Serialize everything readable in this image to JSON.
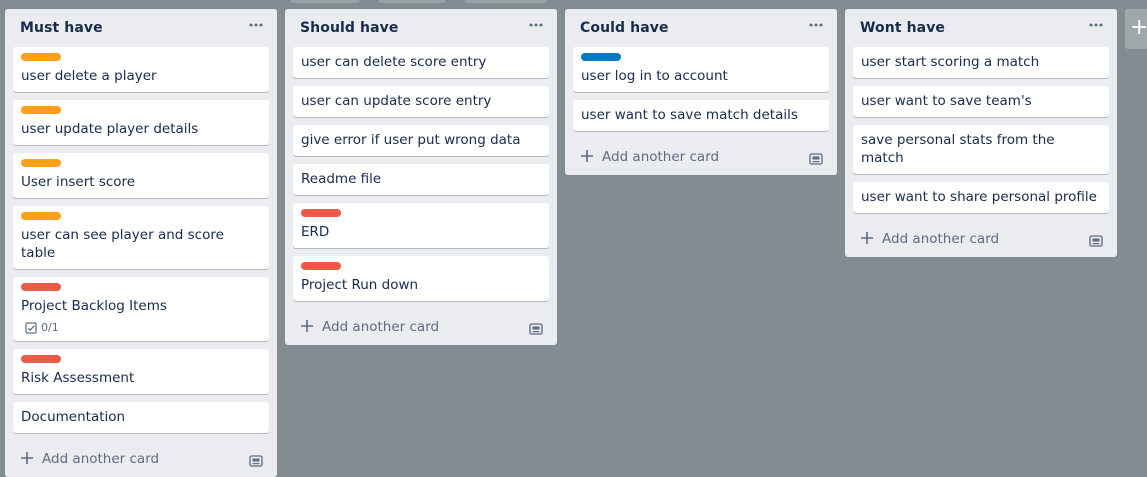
{
  "lists": [
    {
      "title": "Must have",
      "cards": [
        {
          "label": "orange",
          "text": "user delete a player"
        },
        {
          "label": "orange",
          "text": "user update player details"
        },
        {
          "label": "orange",
          "text": "User insert score"
        },
        {
          "label": "orange",
          "text": "user can see player and score table"
        },
        {
          "label": "red",
          "text": "Project Backlog Items",
          "badge": "0/1"
        },
        {
          "label": "red",
          "text": "Risk Assessment"
        },
        {
          "label": null,
          "text": "Documentation"
        }
      ],
      "add_label": "Add another card"
    },
    {
      "title": "Should have",
      "cards": [
        {
          "label": null,
          "text": "user can delete score entry"
        },
        {
          "label": null,
          "text": "user can update score entry"
        },
        {
          "label": null,
          "text": "give error if user put wrong data"
        },
        {
          "label": null,
          "text": "Readme file"
        },
        {
          "label": "red",
          "text": "ERD"
        },
        {
          "label": "red",
          "text": "Project Run down"
        }
      ],
      "add_label": "Add another card"
    },
    {
      "title": "Could have",
      "cards": [
        {
          "label": "blue",
          "text": "user log in to account"
        },
        {
          "label": null,
          "text": "user want to save match details"
        }
      ],
      "add_label": "Add another card"
    },
    {
      "title": "Wont have",
      "cards": [
        {
          "label": null,
          "text": "user start scoring a match"
        },
        {
          "label": null,
          "text": "user want to save team's"
        },
        {
          "label": null,
          "text": "save personal stats from the match"
        },
        {
          "label": null,
          "text": "user want to share personal profile"
        }
      ],
      "add_label": "Add another card"
    }
  ],
  "label_colors": {
    "orange": "#ff9f1a",
    "red": "#eb5a46",
    "blue": "#0079bf"
  },
  "icons": {
    "list_menu": "ellipsis-icon",
    "add": "plus-icon",
    "template": "card-template-icon",
    "checklist": "checklist-icon",
    "add_list": "plus-icon"
  }
}
